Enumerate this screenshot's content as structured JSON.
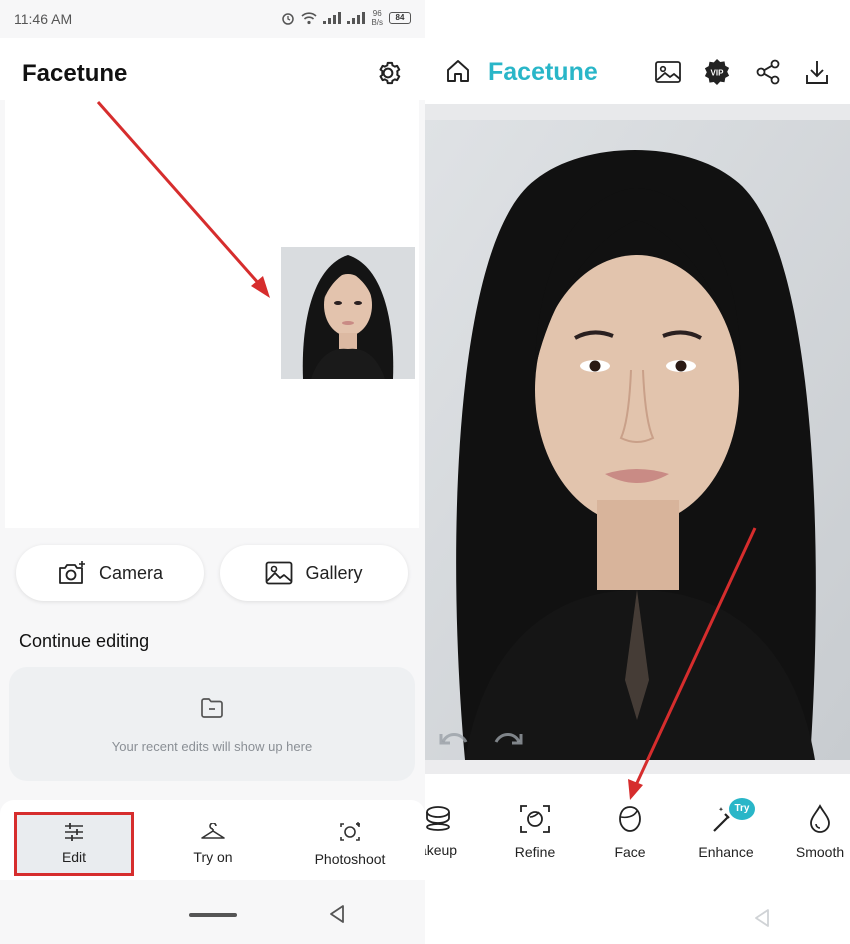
{
  "status": {
    "time": "11:46 AM",
    "speed_value": "96",
    "speed_unit": "B/s",
    "battery": "84"
  },
  "left": {
    "brand": "Facetune",
    "buttons": {
      "camera": "Camera",
      "gallery": "Gallery"
    },
    "continue_title": "Continue editing",
    "recent_empty": "Your recent edits will show up here",
    "nav": {
      "edit": "Edit",
      "try_on": "Try on",
      "photoshoot": "Photoshoot"
    }
  },
  "right": {
    "brand": "Facetune",
    "vip_label": "VIP",
    "tools": [
      {
        "label": "akeup",
        "icon": "makeup-icon"
      },
      {
        "label": "Refine",
        "icon": "refine-icon"
      },
      {
        "label": "Face",
        "icon": "face-icon"
      },
      {
        "label": "Enhance",
        "icon": "magic-wand-icon",
        "badge": "Try"
      },
      {
        "label": "Smooth",
        "icon": "drop-icon"
      }
    ]
  },
  "colors": {
    "brand": "#29b6c8",
    "highlight": "#d62d2d",
    "annotation_arrow": "#d62d2d"
  }
}
